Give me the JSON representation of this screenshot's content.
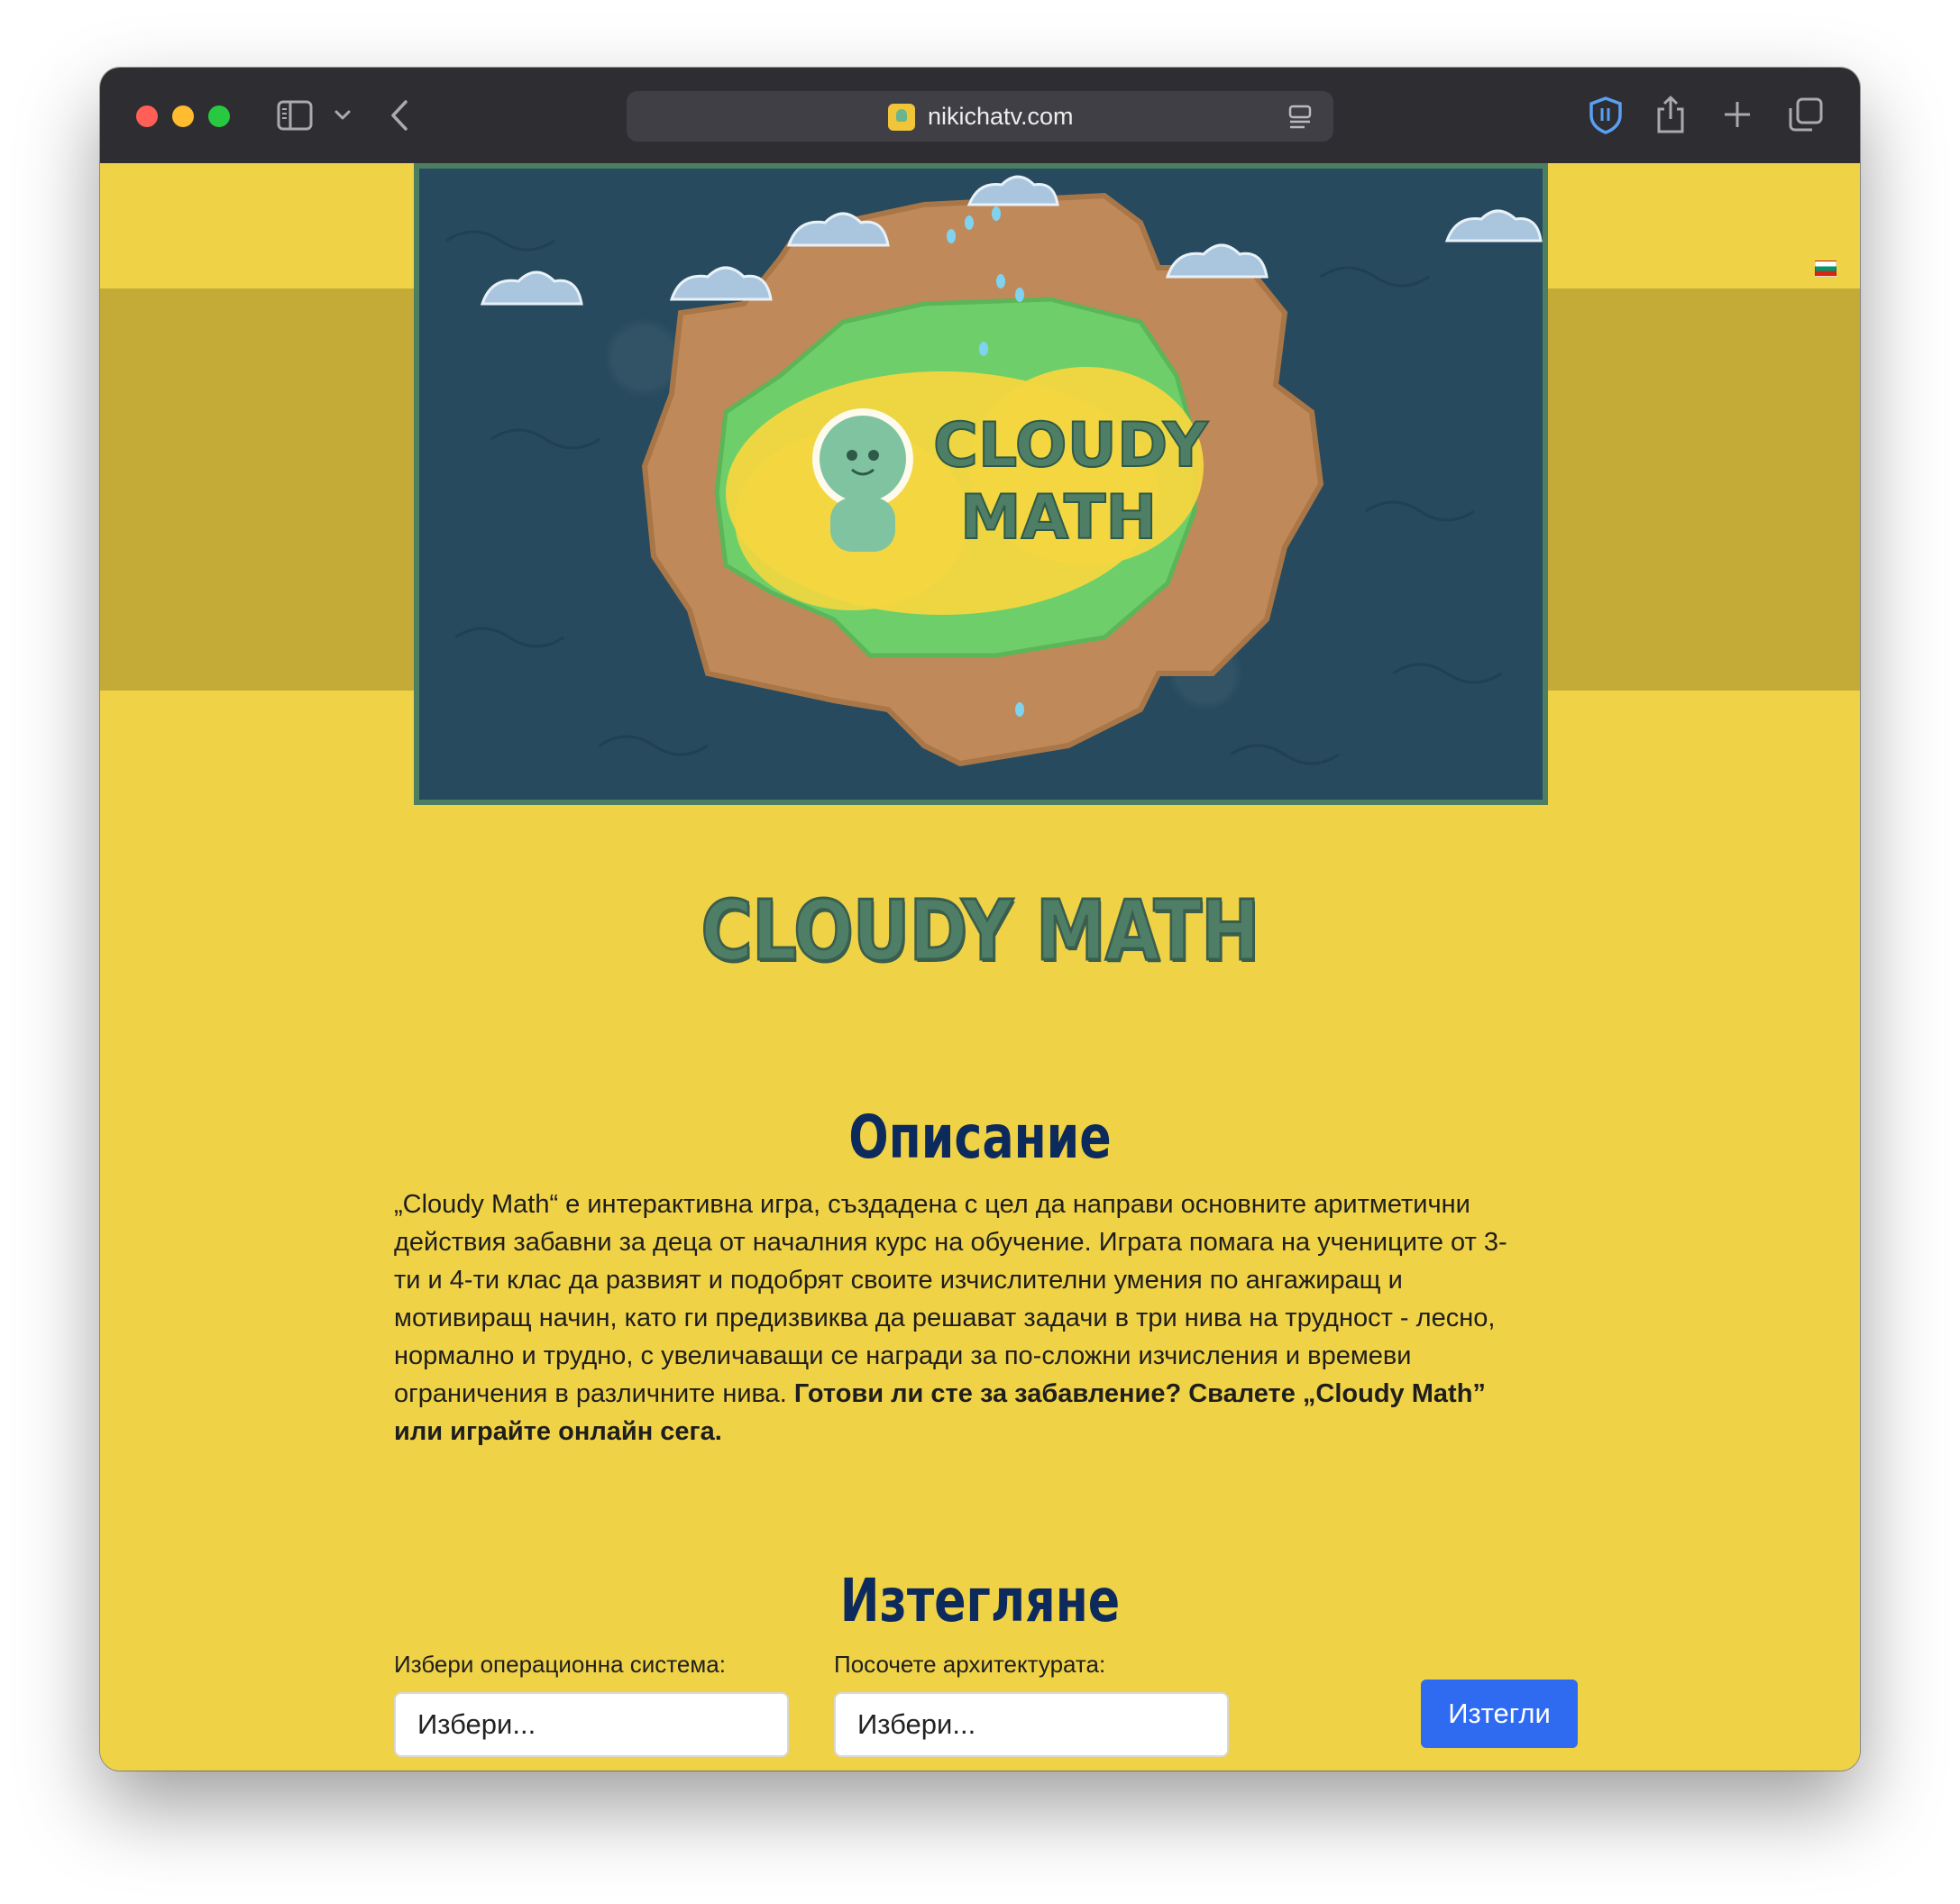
{
  "browser": {
    "url": "nikichatv.com"
  },
  "banner": {
    "logo_line1": "CLOUDY",
    "logo_line2": "MATH"
  },
  "page": {
    "game_title": "CLOUDY MATH",
    "description": {
      "heading": "Описание",
      "text": "„Cloudy Math“ е интерактивна игра, създадена с цел да направи основните аритметични действия забавни за деца от началния курс на обучение. Играта помага на учениците от 3-ти и 4-ти клас да развият и подобрят своите изчислителни умения по ангажиращ и мотивиращ начин, като ги предизвиква да решават задачи в три нива на трудност - лесно, нормално и трудно, с увеличаващи се награди за по-сложни изчисления и времеви ограничения в различните нива. ",
      "emphasis": "Готови ли сте за забавление? Свалете „Cloudy Math” или играйте онлайн сега."
    },
    "download": {
      "heading": "Изтегляне",
      "os_label": "Избери операционна система:",
      "os_value": "Избери...",
      "arch_label": "Посочете архитектурата:",
      "arch_value": "Избери...",
      "button_label": "Изтегли"
    }
  },
  "colors": {
    "page_bg": "#F0D246",
    "band": "#C4AB37",
    "heading": "#0D2A5C",
    "title_green": "#4F7E67",
    "button": "#2F6BF0"
  }
}
